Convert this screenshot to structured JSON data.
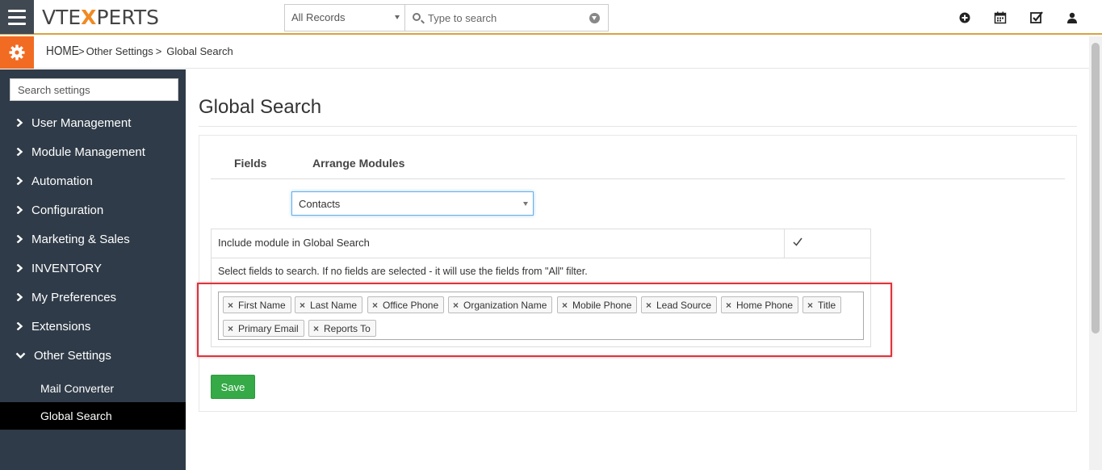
{
  "header": {
    "logo_left": "VTE",
    "logo_x": "X",
    "logo_right": "PERTS",
    "records_select": "All Records",
    "search_placeholder": "Type to search"
  },
  "breadcrumb": {
    "home": "HOME",
    "sep1": ">",
    "section": "Other Settings",
    "sep2": ">",
    "current": "Global Search"
  },
  "sidebar": {
    "search_placeholder": "Search settings",
    "items": [
      {
        "label": "User Management"
      },
      {
        "label": "Module Management"
      },
      {
        "label": "Automation"
      },
      {
        "label": "Configuration"
      },
      {
        "label": "Marketing & Sales"
      },
      {
        "label": "INVENTORY"
      },
      {
        "label": "My Preferences"
      },
      {
        "label": "Extensions"
      },
      {
        "label": "Other Settings"
      }
    ],
    "subitems": [
      {
        "label": "Mail Converter"
      },
      {
        "label": "Global Search"
      }
    ]
  },
  "main": {
    "title": "Global Search",
    "tabs": [
      {
        "label": "Fields"
      },
      {
        "label": "Arrange Modules"
      }
    ],
    "module_select": "Contacts",
    "include_label": "Include module in Global Search",
    "include_checked": true,
    "fields_help": "Select fields to search. If no fields are selected - it will use the fields from \"All\" filter.",
    "fields": [
      {
        "label": "First Name"
      },
      {
        "label": "Last Name"
      },
      {
        "label": "Office Phone"
      },
      {
        "label": "Organization Name"
      },
      {
        "label": "Mobile Phone"
      },
      {
        "label": "Lead Source"
      },
      {
        "label": "Home Phone"
      },
      {
        "label": "Title"
      },
      {
        "label": "Primary Email"
      },
      {
        "label": "Reports To"
      }
    ],
    "tag_remove_glyph": "×",
    "save_label": "Save"
  },
  "colors": {
    "sidebar_bg": "#2f3b48",
    "accent_orange": "#f26b22",
    "save_green": "#35aa47",
    "highlight_red": "#e0333c"
  },
  "icons": {
    "top_right": [
      "plus-circle-icon",
      "calendar-icon",
      "checkbox-icon",
      "user-icon"
    ]
  }
}
